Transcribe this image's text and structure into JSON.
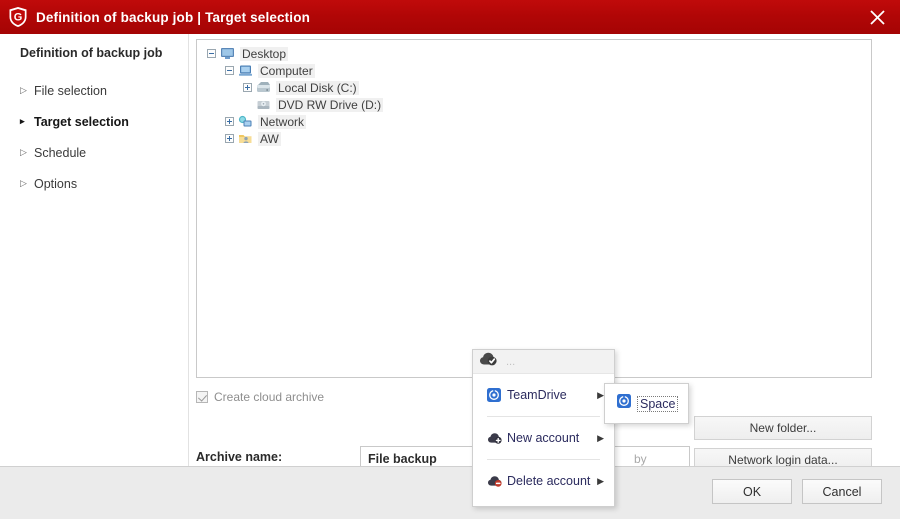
{
  "window": {
    "title": "Definition of backup job | Target selection",
    "logo_icon": "gdata-shield-icon",
    "close_icon": "close-icon",
    "titlebar_color": "#b00606"
  },
  "sidebar": {
    "heading": "Definition of backup job",
    "items": [
      {
        "label": "File selection",
        "icon": "chevron-right-icon",
        "active": false
      },
      {
        "label": "Target selection",
        "icon": "chevron-right-icon",
        "active": true
      },
      {
        "label": "Schedule",
        "icon": "chevron-right-icon",
        "active": false
      },
      {
        "label": "Options",
        "icon": "chevron-right-icon",
        "active": false
      }
    ]
  },
  "tree": {
    "nodes": [
      {
        "label": "Desktop",
        "icon": "monitor-icon",
        "state": "expanded",
        "depth": 0
      },
      {
        "label": "Computer",
        "icon": "computer-icon",
        "state": "expanded",
        "depth": 1
      },
      {
        "label": "Local Disk (C:)",
        "icon": "harddisk-icon",
        "state": "collapsed",
        "depth": 2
      },
      {
        "label": "DVD RW Drive (D:)",
        "icon": "dvd-drive-icon",
        "state": "leaf",
        "depth": 2
      },
      {
        "label": "Network",
        "icon": "network-icon",
        "state": "collapsed",
        "depth": 1
      },
      {
        "label": "AW",
        "icon": "user-folder-icon",
        "state": "collapsed",
        "depth": 1
      }
    ]
  },
  "options": {
    "cloud_archive_label": "Create cloud archive",
    "cloud_archive_checked": true,
    "archive_name_label": "Archive name:",
    "archive_name_value": "File backup",
    "archive_name_placeholder": "File backup",
    "obscured_text": "by"
  },
  "buttons": {
    "new_folder": "New folder...",
    "network_login": "Network login data...",
    "ok": "OK",
    "cancel": "Cancel"
  },
  "context_menu": {
    "header_icon": "cloud-check-icon",
    "header_text": "...",
    "items": [
      {
        "label": "TeamDrive",
        "icon": "teamdrive-icon",
        "submenu_icon": "submenu-arrow-icon",
        "has_submenu": true
      },
      {
        "label": "New account",
        "icon": "cloud-add-icon",
        "submenu_icon": "submenu-arrow-icon",
        "has_submenu": true
      },
      {
        "label": "Delete account",
        "icon": "cloud-delete-icon",
        "submenu_icon": "submenu-arrow-icon",
        "has_submenu": true
      }
    ]
  },
  "submenu": {
    "icon": "teamdrive-icon",
    "label": "Space"
  }
}
